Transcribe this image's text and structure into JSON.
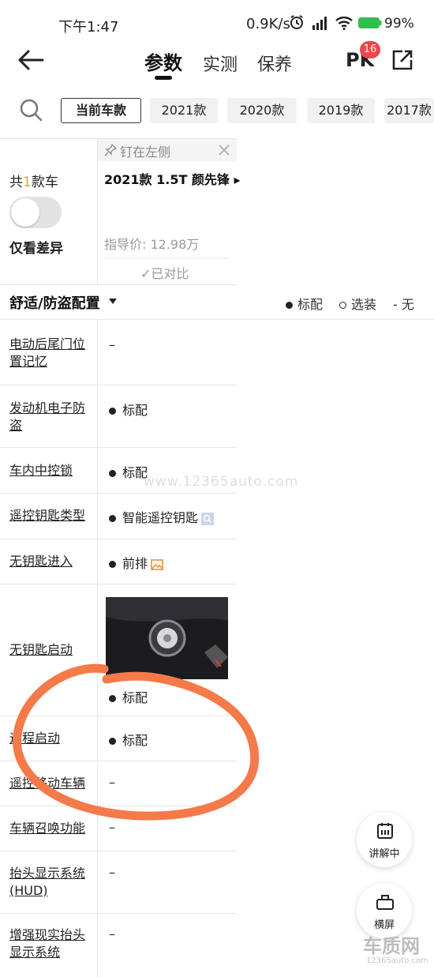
{
  "status": {
    "time": "下午1:47",
    "speed": "0.9K/s",
    "battery": "99%"
  },
  "nav": {
    "tabs": [
      "参数",
      "实测",
      "保养"
    ],
    "pk": "PK",
    "pk_badge": "16"
  },
  "filter": {
    "chips": [
      "当前车款",
      "2021款",
      "2020款",
      "2019款",
      "2017款"
    ]
  },
  "compare": {
    "count_prefix": "共",
    "count_num": "1",
    "count_suffix": "款车",
    "diff_only": "仅看差异",
    "pin_label": "钉在左侧",
    "car_name": "2021款 1.5T 颜先锋 ▸",
    "guide_price": "指导价: 12.98万",
    "compared": "✓已对比"
  },
  "section": {
    "title": "舒适/防盗配置",
    "legend_std": "标配",
    "legend_opt": "选装",
    "legend_none": "- 无"
  },
  "rows": [
    {
      "label": "电动后尾门位置记忆",
      "value": "–"
    },
    {
      "label": "发动机电子防盗",
      "value": "标配"
    },
    {
      "label": "车内中控锁",
      "value": "标配"
    },
    {
      "label": "遥控钥匙类型",
      "value": "智能遥控钥匙"
    },
    {
      "label": "无钥匙进入",
      "value": "前排"
    },
    {
      "label": "无钥匙启动",
      "value": "标配"
    },
    {
      "label": "远程启动",
      "value": "标配"
    },
    {
      "label": "遥控移动车辆",
      "value": "–"
    },
    {
      "label": "车辆召唤功能",
      "value": "–"
    },
    {
      "label": "抬头显示系统(HUD)",
      "value": "–"
    },
    {
      "label": "增强现实抬头显示系统",
      "value": "–"
    }
  ],
  "floats": {
    "explain": "讲解中",
    "landscape": "横屏"
  },
  "watermark": "www.12365auto.com",
  "logo": {
    "text": "车质网",
    "url": "12365auto.com"
  },
  "colors": {
    "annotation": "#f47a4a",
    "badge": "#f0464b",
    "accent_num": "#f0a020"
  }
}
